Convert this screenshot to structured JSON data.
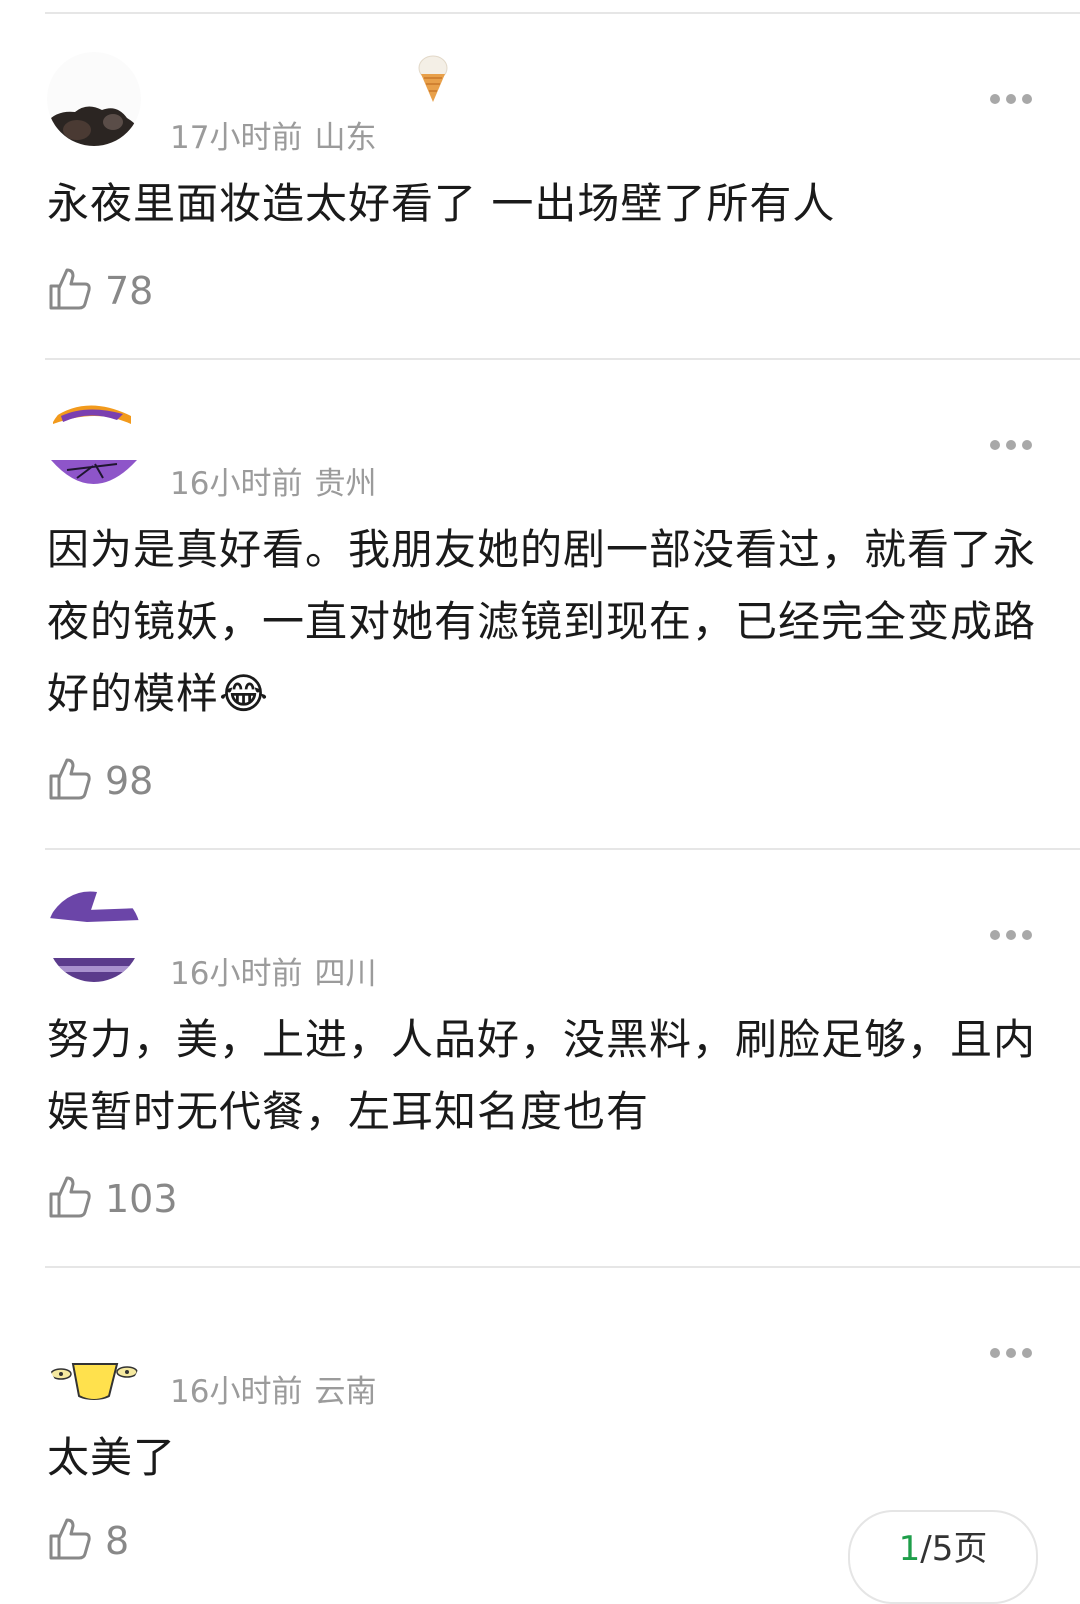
{
  "comments": [
    {
      "time": "17小时前",
      "location": "山东",
      "text": "永夜里面妆造太好看了 一出场壁了所有人",
      "likes": "78",
      "avatar_icon": "user-photo-avatar"
    },
    {
      "time": "16小时前",
      "location": "贵州",
      "text": "因为是真好看。我朋友她的剧一部没看过，就看了永夜的镜妖，一直对她有滤镜到现在，已经完全变成路好的模样",
      "emoji": "😂",
      "likes": "98",
      "avatar_icon": "purple-cartoon-avatar"
    },
    {
      "time": "16小时前",
      "location": "四川",
      "text": "努力，美，上进，人品好，没黑料，刷脸足够，且内娱暂时无代餐，左耳知名度也有",
      "likes": "103",
      "avatar_icon": "purple-banner-avatar"
    },
    {
      "time": "16小时前",
      "location": "云南",
      "text": "太美了",
      "likes": "8",
      "avatar_icon": "yellow-cartoon-avatar"
    }
  ],
  "pager": {
    "current": "1",
    "rest": "/5页"
  },
  "icons": {
    "like": "thumbs-up-icon",
    "more": "more-dots-icon",
    "decoration": "ice-cream-icon"
  }
}
